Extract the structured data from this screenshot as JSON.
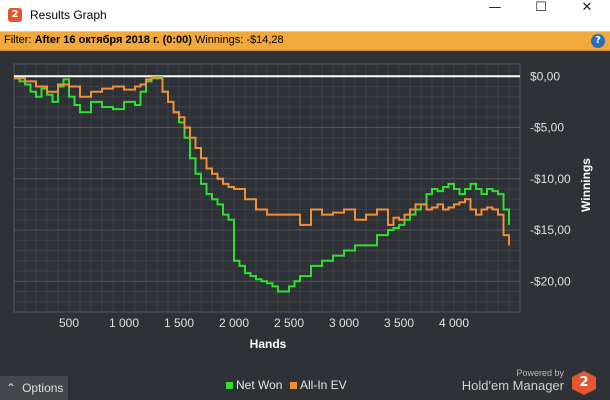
{
  "window": {
    "title": "Results Graph",
    "minimize": "—",
    "maximize": "☐",
    "close": "✕"
  },
  "filter": {
    "prefix": "Filter:",
    "value": "After 16 октября 2018 г. (0:00)",
    "winnings_label": "Winnings:",
    "winnings_value": "-$14,28"
  },
  "help_label": "?",
  "options_label": "Options",
  "powered_by": "Powered by",
  "brand": "Hold'em Manager",
  "brand_logo": "2",
  "colors": {
    "net_won": "#33dd33",
    "all_in_ev": "#f0903a",
    "background": "#2e3135",
    "grid": "#4a4e53"
  },
  "chart_data": {
    "type": "line",
    "xlabel": "Hands",
    "ylabel": "Winnings",
    "xlim": [
      0,
      4600
    ],
    "ylim": [
      -23,
      1.2
    ],
    "x_ticks": [
      500,
      1000,
      1500,
      2000,
      2500,
      3000,
      3500,
      4000
    ],
    "x_tick_labels": [
      "500",
      "1 000",
      "1 500",
      "2 000",
      "2 500",
      "3 000",
      "3 500",
      "4 000"
    ],
    "y_ticks": [
      0,
      -5,
      -10,
      -15,
      -20
    ],
    "y_tick_labels": [
      "$0,00",
      "-$5,00",
      "-$10,00",
      "-$15,00",
      "-$20,00"
    ],
    "grid": true,
    "legend_position": "bottom-center",
    "series": [
      {
        "name": "Net Won",
        "color": "#33dd33",
        "x": [
          0,
          50,
          100,
          150,
          200,
          250,
          300,
          350,
          400,
          450,
          500,
          550,
          600,
          700,
          800,
          900,
          1000,
          1100,
          1150,
          1200,
          1250,
          1300,
          1350,
          1400,
          1450,
          1500,
          1550,
          1600,
          1650,
          1700,
          1750,
          1800,
          1850,
          1900,
          1950,
          2000,
          2050,
          2100,
          2150,
          2200,
          2250,
          2300,
          2350,
          2400,
          2450,
          2500,
          2550,
          2600,
          2700,
          2800,
          2900,
          3000,
          3100,
          3200,
          3300,
          3400,
          3450,
          3500,
          3550,
          3600,
          3650,
          3700,
          3750,
          3800,
          3850,
          3900,
          3950,
          4000,
          4050,
          4100,
          4150,
          4200,
          4250,
          4300,
          4350,
          4400,
          4450,
          4500
        ],
        "y": [
          -0.2,
          -0.5,
          -0.8,
          -1.5,
          -2.0,
          -1.2,
          -1.8,
          -2.5,
          -1.0,
          -0.3,
          -2.0,
          -2.8,
          -3.5,
          -2.5,
          -3.0,
          -3.2,
          -2.5,
          -2.8,
          -1.5,
          -0.5,
          -0.2,
          -0.1,
          -1.5,
          -2.5,
          -3.5,
          -4.5,
          -6.0,
          -8.0,
          -9.5,
          -10.5,
          -11.5,
          -12.0,
          -12.5,
          -13.5,
          -14.0,
          -18.0,
          -18.5,
          -19.2,
          -19.5,
          -19.8,
          -20.0,
          -20.2,
          -20.5,
          -21.0,
          -21.0,
          -20.5,
          -20.0,
          -19.5,
          -18.5,
          -18.0,
          -17.5,
          -17.0,
          -16.5,
          -16.5,
          -15.5,
          -15.0,
          -14.8,
          -14.5,
          -14.0,
          -13.5,
          -13.0,
          -12.5,
          -11.5,
          -11.0,
          -11.2,
          -10.8,
          -10.5,
          -11.0,
          -11.5,
          -11.0,
          -10.5,
          -11.0,
          -11.5,
          -11.0,
          -11.2,
          -11.5,
          -13.0,
          -14.5
        ]
      },
      {
        "name": "All-In EV",
        "color": "#f0903a",
        "x": [
          0,
          100,
          200,
          300,
          400,
          500,
          600,
          700,
          800,
          900,
          1000,
          1100,
          1150,
          1200,
          1250,
          1300,
          1350,
          1400,
          1450,
          1500,
          1550,
          1600,
          1650,
          1700,
          1750,
          1800,
          1850,
          1900,
          1950,
          2000,
          2100,
          2200,
          2300,
          2400,
          2500,
          2600,
          2700,
          2800,
          2900,
          3000,
          3100,
          3200,
          3300,
          3400,
          3450,
          3500,
          3550,
          3600,
          3650,
          3700,
          3750,
          3800,
          3850,
          3900,
          3950,
          4000,
          4050,
          4100,
          4150,
          4200,
          4250,
          4300,
          4350,
          4400,
          4450,
          4500
        ],
        "y": [
          -0.2,
          -0.5,
          -1.0,
          -1.5,
          -0.8,
          -1.0,
          -2.0,
          -1.5,
          -1.2,
          -1.0,
          -1.3,
          -1.0,
          -0.8,
          -0.3,
          -0.1,
          -0.2,
          -1.5,
          -2.5,
          -3.5,
          -4.0,
          -5.0,
          -6.0,
          -7.0,
          -8.0,
          -9.0,
          -9.5,
          -10.0,
          -10.5,
          -10.8,
          -11.0,
          -12.0,
          -13.0,
          -13.5,
          -13.5,
          -13.5,
          -14.5,
          -13.0,
          -13.5,
          -13.3,
          -13.0,
          -14.0,
          -13.5,
          -13.0,
          -14.5,
          -13.8,
          -14.0,
          -13.5,
          -13.0,
          -12.5,
          -12.5,
          -13.0,
          -12.8,
          -12.5,
          -13.0,
          -12.8,
          -12.5,
          -12.3,
          -12.0,
          -13.0,
          -13.5,
          -13.0,
          -12.8,
          -13.0,
          -13.5,
          -15.5,
          -16.5
        ]
      }
    ]
  }
}
